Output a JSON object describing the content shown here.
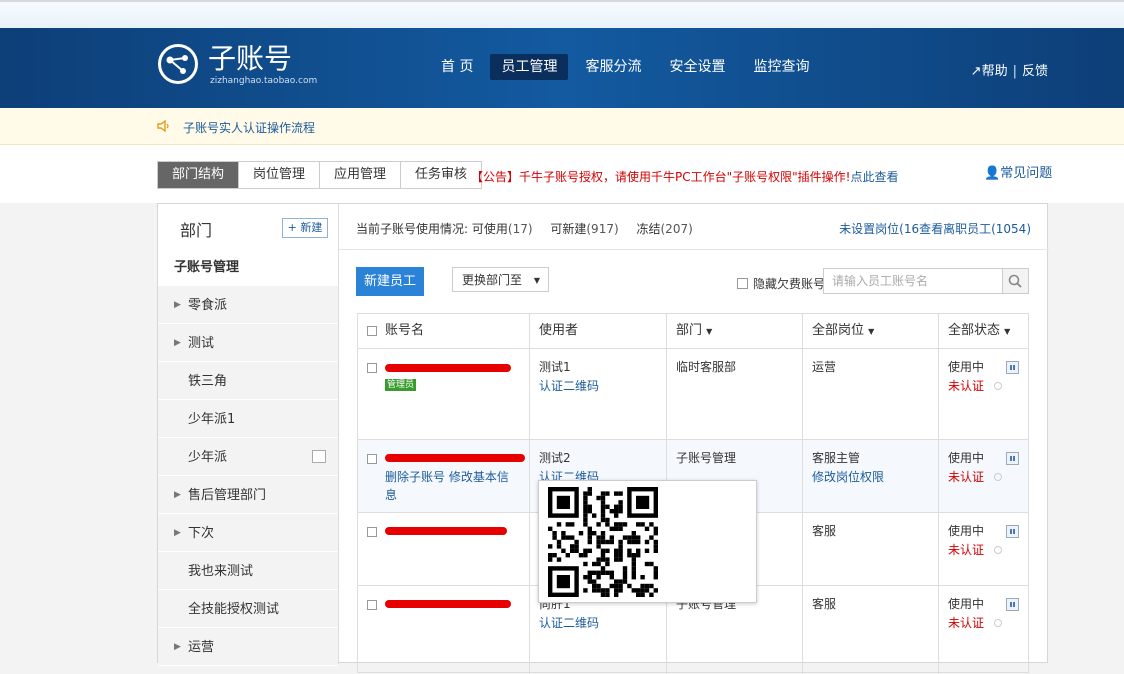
{
  "header": {
    "logo_title": "子账号",
    "logo_sub": "zizhanghao.taobao.com",
    "nav": [
      {
        "label": "首 页",
        "active": false
      },
      {
        "label": "员工管理",
        "active": true
      },
      {
        "label": "客服分流",
        "active": false
      },
      {
        "label": "安全设置",
        "active": false
      },
      {
        "label": "监控查询",
        "active": false
      }
    ],
    "help": "帮助",
    "feedback": "反馈"
  },
  "notice": {
    "text": "子账号实人认证操作流程"
  },
  "tabs": [
    {
      "label": "部门结构",
      "active": true
    },
    {
      "label": "岗位管理",
      "active": false
    },
    {
      "label": "应用管理",
      "active": false
    },
    {
      "label": "任务审核",
      "active": false
    }
  ],
  "announcement": {
    "text": "【公告】千牛子账号授权，请使用千牛PC工作台\"子账号权限\"插件操作!",
    "link": "点此查看"
  },
  "faq": "常见问题",
  "sidebar": {
    "title": "部门",
    "new_button": "+ 新建",
    "items": [
      {
        "label": "子账号管理",
        "active": true,
        "expandable": false
      },
      {
        "label": "零食派",
        "active": false,
        "expandable": true
      },
      {
        "label": "测试",
        "active": false,
        "expandable": true
      },
      {
        "label": "铁三角",
        "active": false,
        "expandable": false
      },
      {
        "label": "少年派1",
        "active": false,
        "expandable": false
      },
      {
        "label": "少年派",
        "active": false,
        "expandable": false
      },
      {
        "label": "售后管理部门",
        "active": false,
        "expandable": true
      },
      {
        "label": "下次",
        "active": false,
        "expandable": true
      },
      {
        "label": "我也来测试",
        "active": false,
        "expandable": false
      },
      {
        "label": "全技能授权测试",
        "active": false,
        "expandable": false
      },
      {
        "label": "运营",
        "active": false,
        "expandable": true
      }
    ]
  },
  "usage": {
    "label": "当前子账号使用情况:",
    "available_label": "可使用",
    "available": "(17)",
    "creatable_label": "可新建",
    "creatable": "(917)",
    "frozen_label": "冻结",
    "frozen": "(207)"
  },
  "unset_link": "未设置岗位(16查看离职员工(1054)",
  "toolbar": {
    "add_label": "新建员工",
    "move_label": "更换部门至",
    "hide_label": "隐藏欠费账号",
    "search_placeholder": "请输入员工账号名"
  },
  "table": {
    "headers": {
      "account": "账号名",
      "user": "使用者",
      "dept": "部门",
      "post": "全部岗位",
      "status": "全部状态"
    },
    "rows": [
      {
        "admin": "管理员",
        "user": "测试1",
        "qr": "认证二维码",
        "dept": "临时客服部",
        "post": "运营",
        "status": "使用中",
        "cert": "未认证"
      },
      {
        "actions": "删除子账号 修改基本信",
        "actions2": "息",
        "user": "测试2",
        "qr": "认证二维码",
        "dept": "子账号管理",
        "post": "客服主管",
        "post_link": "修改岗位权限",
        "status": "使用中",
        "cert": "未认证"
      },
      {
        "post": "客服",
        "status": "使用中",
        "cert": "未认证"
      },
      {
        "user": "尚肝1",
        "qr": "认证二维码",
        "dept": "子账号管理",
        "post": "客服",
        "status": "使用中",
        "cert": "未认证"
      }
    ]
  },
  "colors": {
    "header": "#135aa0",
    "accent": "#2b83d8",
    "red": "#d40000",
    "link": "#1c5b9b"
  }
}
